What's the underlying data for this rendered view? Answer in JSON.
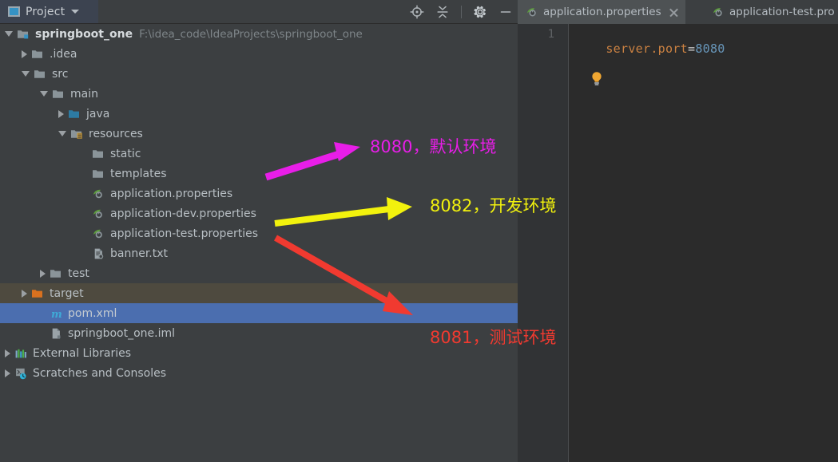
{
  "toolwindow": {
    "title": "Project",
    "dropdown_icon": "chevron-down-icon",
    "panel_icon": "project-window-icon",
    "actions": [
      {
        "name": "locate-icon",
        "tooltip": "Select Opened File"
      },
      {
        "name": "collapse-all-icon",
        "tooltip": "Collapse All"
      },
      {
        "name": "gear-icon",
        "tooltip": "Settings"
      },
      {
        "name": "minimize-icon",
        "tooltip": "Hide"
      }
    ]
  },
  "tree": {
    "rows": [
      {
        "label": "springboot_one",
        "path": "F:\\idea_code\\IdeaProjects\\springboot_one",
        "icon": "module-folder-icon",
        "twisty": "down",
        "indent": 0,
        "state": "normal",
        "bold": true
      },
      {
        "label": ".idea",
        "icon": "folder-icon",
        "twisty": "right",
        "indent": 1,
        "state": "normal"
      },
      {
        "label": "src",
        "icon": "folder-icon",
        "twisty": "down",
        "indent": 1,
        "state": "normal"
      },
      {
        "label": "main",
        "icon": "folder-icon",
        "twisty": "down",
        "indent": 2,
        "state": "normal"
      },
      {
        "label": "java",
        "icon": "source-root-icon",
        "twisty": "right",
        "indent": 3,
        "state": "normal"
      },
      {
        "label": "resources",
        "icon": "resource-root-icon",
        "twisty": "down",
        "indent": 3,
        "state": "normal"
      },
      {
        "label": "static",
        "icon": "folder-icon",
        "twisty": "none",
        "indent": 4,
        "state": "normal"
      },
      {
        "label": "templates",
        "icon": "folder-icon",
        "twisty": "none",
        "indent": 4,
        "state": "normal"
      },
      {
        "label": "application.properties",
        "icon": "spring-properties-icon",
        "twisty": "none",
        "indent": 4,
        "state": "normal"
      },
      {
        "label": "application-dev.properties",
        "icon": "spring-properties-icon",
        "twisty": "none",
        "indent": 4,
        "state": "normal"
      },
      {
        "label": "application-test.properties",
        "icon": "spring-properties-icon",
        "twisty": "none",
        "indent": 4,
        "state": "normal"
      },
      {
        "label": "banner.txt",
        "icon": "text-file-icon",
        "twisty": "none",
        "indent": 4,
        "state": "normal"
      },
      {
        "label": "test",
        "icon": "folder-icon",
        "twisty": "right",
        "indent": 2,
        "state": "normal"
      },
      {
        "label": "target",
        "icon": "excluded-folder-icon",
        "twisty": "right",
        "indent": 1,
        "state": "highlighted"
      },
      {
        "label": "pom.xml",
        "icon": "maven-icon",
        "twisty": "none",
        "indent": 1,
        "state": "selected"
      },
      {
        "label": "springboot_one.iml",
        "icon": "iml-file-icon",
        "twisty": "none",
        "indent": 1,
        "state": "normal"
      },
      {
        "label": "External Libraries",
        "icon": "libraries-icon",
        "twisty": "right",
        "indent": 0,
        "state": "normal"
      },
      {
        "label": "Scratches and Consoles",
        "icon": "scratches-icon",
        "twisty": "right",
        "indent": 0,
        "state": "normal"
      }
    ]
  },
  "editor": {
    "tabs": [
      {
        "label": "application.properties",
        "icon": "spring-properties-icon",
        "active": true,
        "closable": true
      },
      {
        "label": "application-test.pro",
        "icon": "spring-properties-icon",
        "active": false,
        "closable": false
      }
    ],
    "line_numbers": [
      "1"
    ],
    "code": {
      "key": "server.port",
      "eq": "=",
      "value": "8080"
    },
    "intention_icon": "lightbulb-icon"
  },
  "annotations": [
    {
      "id": "magenta",
      "text": "8080，默认环境",
      "color": "#e81ee8"
    },
    {
      "id": "yellow",
      "text": "8082，开发环境",
      "color": "#f2f20d"
    },
    {
      "id": "red",
      "text": "8081，测试环境",
      "color": "#f13a30"
    }
  ],
  "colors": {
    "panel_bg": "#3c3f41",
    "editor_bg": "#2b2b2b",
    "selection_blue": "#4b6eaf",
    "highlight_brown": "#4e4a3f",
    "key_orange": "#cc8242",
    "value_blue": "#6897bb"
  }
}
